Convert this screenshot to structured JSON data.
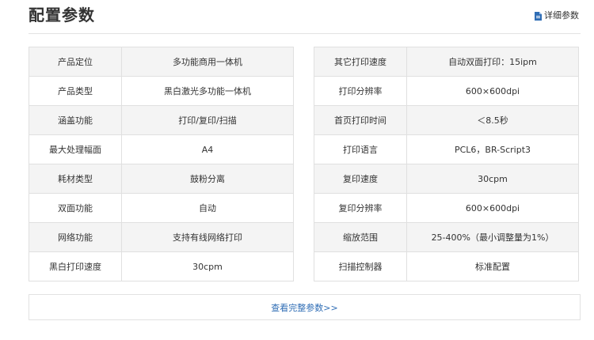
{
  "header": {
    "title": "配置参数",
    "detail_link": "详细参数",
    "detail_icon": "document-icon",
    "accent_color": "#2f6db5"
  },
  "left_table": [
    {
      "label": "产品定位",
      "value": "多功能商用一体机"
    },
    {
      "label": "产品类型",
      "value": "黑白激光多功能一体机"
    },
    {
      "label": "涵盖功能",
      "value": "打印/复印/扫描"
    },
    {
      "label": "最大处理幅面",
      "value": "A4"
    },
    {
      "label": "耗材类型",
      "value": "鼓粉分离"
    },
    {
      "label": "双面功能",
      "value": "自动"
    },
    {
      "label": "网络功能",
      "value": "支持有线网络打印"
    },
    {
      "label": "黑白打印速度",
      "value": "30cpm"
    }
  ],
  "right_table": [
    {
      "label": "其它打印速度",
      "value": "自动双面打印：15ipm"
    },
    {
      "label": "打印分辨率",
      "value": "600×600dpi"
    },
    {
      "label": "首页打印时间",
      "value": "＜8.5秒"
    },
    {
      "label": "打印语言",
      "value": "PCL6，BR-Script3"
    },
    {
      "label": "复印速度",
      "value": "30cpm"
    },
    {
      "label": "复印分辨率",
      "value": "600×600dpi"
    },
    {
      "label": "缩放范围",
      "value": "25-400%（最小调整量为1%）"
    },
    {
      "label": "扫描控制器",
      "value": "标准配置"
    }
  ],
  "footer": {
    "more_link": "查看完整参数>>"
  }
}
